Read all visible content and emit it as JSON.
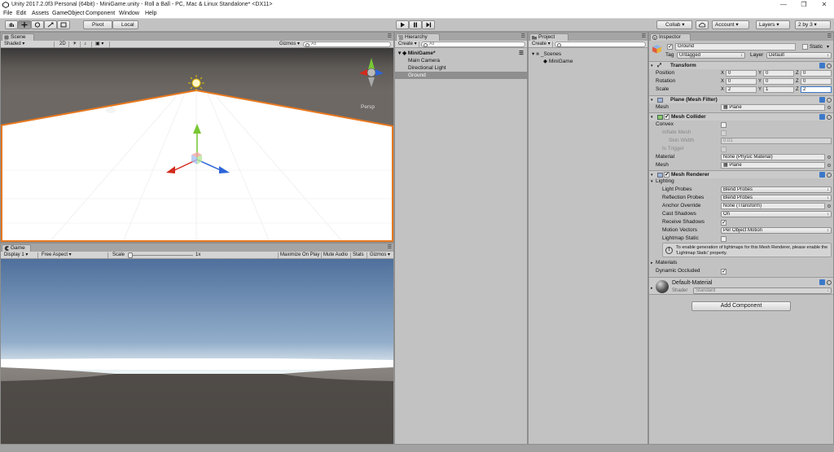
{
  "window": {
    "title": "Unity 2017.2.0f3 Personal (64bit) - MiniGame.unity - Roll a Ball - PC, Mac & Linux Standalone* <DX11>",
    "minimize": "—",
    "maximize": "❐",
    "close": "✕"
  },
  "menu": [
    "File",
    "Edit",
    "Assets",
    "GameObject",
    "Component",
    "Window",
    "Help"
  ],
  "toolbar": {
    "pivot": "Pivot",
    "global": "Local",
    "collab": "Collab",
    "account": "Account",
    "layers": "Layers",
    "layout": "2 by 3"
  },
  "scene": {
    "tab": "Scene",
    "shading": "Shaded",
    "mode2d": "2D",
    "gizmos": "Gizmos",
    "search": "All",
    "persp": "Persp"
  },
  "game": {
    "tab": "Game",
    "display": "Display 1",
    "aspect": "Free Aspect",
    "scale_label": "Scale",
    "scale_value": "1x",
    "maximize": "Maximize On Play",
    "mute": "Mute Audio",
    "stats": "Stats",
    "gizmos": "Gizmos"
  },
  "hierarchy": {
    "tab": "Hierarchy",
    "create": "Create",
    "search": "All",
    "scene": "MiniGame*",
    "items": [
      "Main Camera",
      "Directional Light",
      "Ground"
    ]
  },
  "project": {
    "tab": "Project",
    "create": "Create",
    "folder": "_Scenes",
    "items": [
      "MiniGame"
    ]
  },
  "inspector": {
    "tab": "Inspector",
    "object_name": "Ground",
    "static_label": "Static",
    "tag_label": "Tag",
    "tag_value": "Untagged",
    "layer_label": "Layer",
    "layer_value": "Default",
    "transform": {
      "title": "Transform",
      "position_label": "Position",
      "rotation_label": "Rotation",
      "scale_label": "Scale",
      "x": "X",
      "y": "Y",
      "z": "Z",
      "position": [
        "0",
        "0",
        "0"
      ],
      "rotation": [
        "0",
        "0",
        "0"
      ],
      "scale": [
        "2",
        "1",
        "2"
      ]
    },
    "mesh_filter": {
      "title": "Plane (Mesh Filter)",
      "mesh_label": "Mesh",
      "mesh_value": "Plane"
    },
    "mesh_collider": {
      "title": "Mesh Collider",
      "convex": "Convex",
      "inflate": "Inflate Mesh",
      "skin_width": "Skin Width",
      "skin_value": "0.01",
      "is_trigger": "Is Trigger",
      "material_label": "Material",
      "material_value": "None (Physic Material)",
      "mesh_label": "Mesh",
      "mesh_value": "Plane"
    },
    "mesh_renderer": {
      "title": "Mesh Renderer",
      "lighting": "Lighting",
      "light_probes_label": "Light Probes",
      "light_probes_value": "Blend Probes",
      "reflection_label": "Reflection Probes",
      "reflection_value": "Blend Probes",
      "anchor_label": "Anchor Override",
      "anchor_value": "None (Transform)",
      "cast_label": "Cast Shadows",
      "cast_value": "On",
      "receive_label": "Receive Shadows",
      "motion_label": "Motion Vectors",
      "motion_value": "Per Object Motion",
      "lightmap_label": "Lightmap Static",
      "info": "To enable generation of lightmaps for this Mesh Renderer, please enable the 'Lightmap Static' property.",
      "materials": "Materials",
      "dynamic": "Dynamic Occluded"
    },
    "material": {
      "name": "Default-Material",
      "shader_label": "Shader",
      "shader_value": "Standard"
    },
    "add_component": "Add Component"
  }
}
